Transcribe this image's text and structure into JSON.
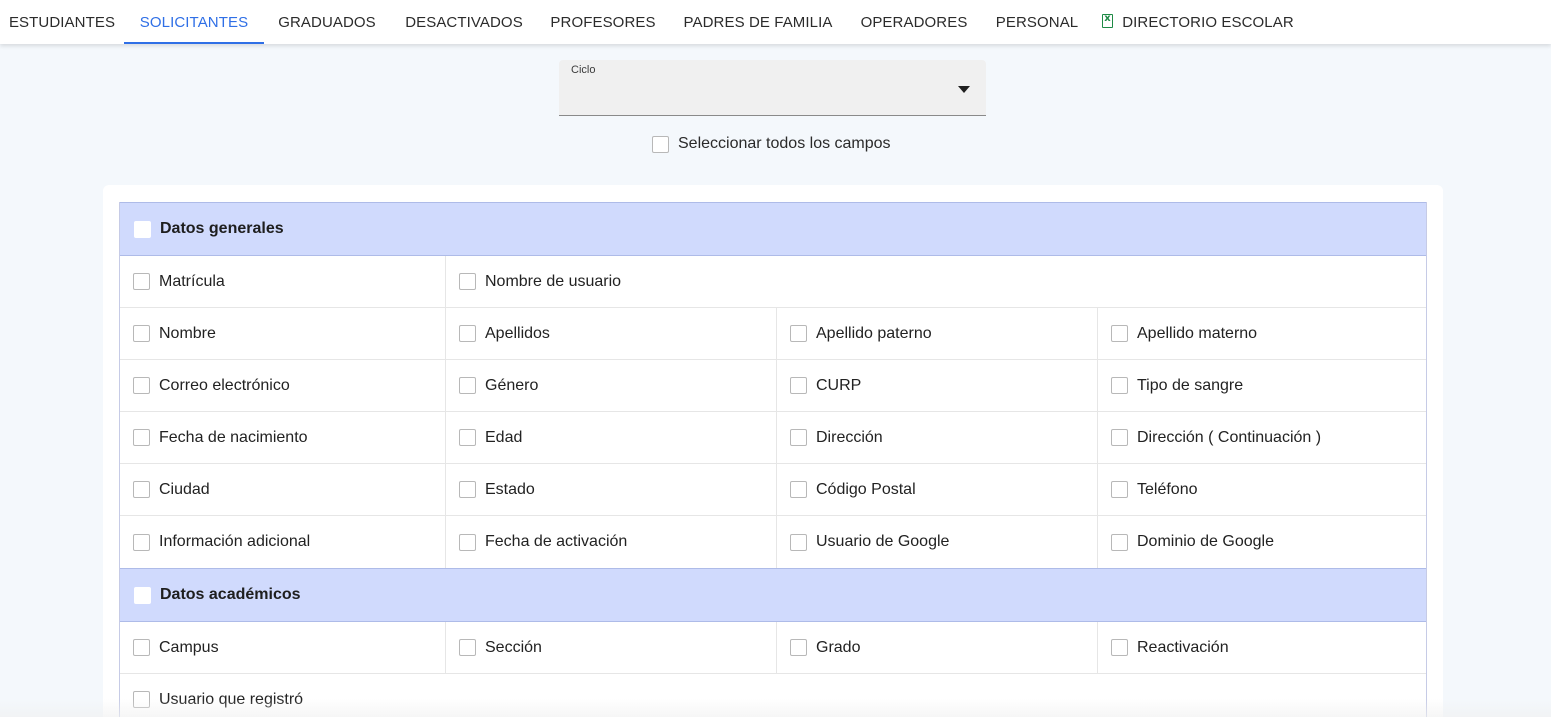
{
  "tabs": [
    {
      "label": "ESTUDIANTES",
      "active": false
    },
    {
      "label": "SOLICITANTES",
      "active": true
    },
    {
      "label": "GRADUADOS",
      "active": false
    },
    {
      "label": "DESACTIVADOS",
      "active": false
    },
    {
      "label": "PROFESORES",
      "active": false
    },
    {
      "label": "PADRES DE FAMILIA",
      "active": false
    },
    {
      "label": "OPERADORES",
      "active": false
    },
    {
      "label": "PERSONAL",
      "active": false
    },
    {
      "label": "DIRECTORIO ESCOLAR",
      "active": false,
      "icon": "excel-file-icon"
    }
  ],
  "colors": {
    "accent": "#2f6fe6",
    "section_bg": "#d0dafd",
    "excel_green": "#1e8a45"
  },
  "cycle_select": {
    "label": "Ciclo",
    "value": ""
  },
  "select_all": {
    "label": "Seleccionar todos los campos",
    "checked": false
  },
  "sections": [
    {
      "title": "Datos generales",
      "checked": false,
      "rows": [
        [
          "Matrícula",
          "Nombre de usuario"
        ],
        [
          "Nombre",
          "Apellidos",
          "Apellido paterno",
          "Apellido materno"
        ],
        [
          "Correo electrónico",
          "Género",
          "CURP",
          "Tipo de sangre"
        ],
        [
          "Fecha de nacimiento",
          "Edad",
          "Dirección",
          "Dirección ( Continuación )"
        ],
        [
          "Ciudad",
          "Estado",
          "Código Postal",
          "Teléfono"
        ],
        [
          "Información adicional",
          "Fecha de activación",
          "Usuario de Google",
          "Dominio de Google"
        ]
      ]
    },
    {
      "title": "Datos académicos",
      "checked": false,
      "rows": [
        [
          "Campus",
          "Sección",
          "Grado",
          "Reactivación"
        ],
        [
          "Usuario que registró"
        ]
      ]
    }
  ]
}
